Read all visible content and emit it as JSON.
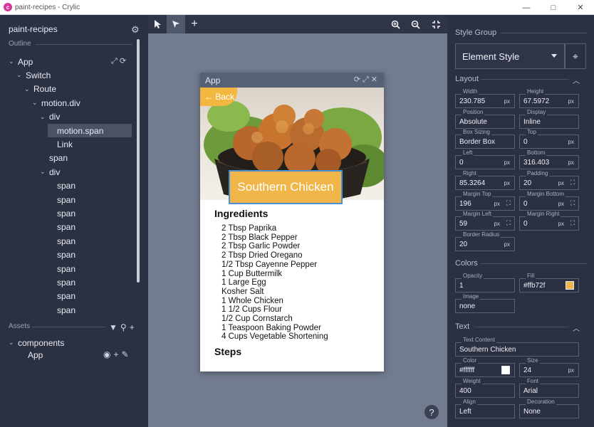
{
  "window": {
    "title": "paint-recipes - Crylic",
    "logo_glyph": "c",
    "controls": {
      "minimize": "—",
      "maximize": "□",
      "close": "✕"
    }
  },
  "left_panel": {
    "project_name": "paint-recipes",
    "outline_label": "Outline",
    "tree": [
      {
        "label": "App",
        "depth": 0,
        "expanded": true
      },
      {
        "label": "Switch",
        "depth": 1,
        "expanded": true
      },
      {
        "label": "Route",
        "depth": 2,
        "expanded": true
      },
      {
        "label": "motion.div",
        "depth": 3,
        "expanded": true
      },
      {
        "label": "div",
        "depth": 4,
        "expanded": true
      },
      {
        "label": "motion.span",
        "depth": 5,
        "selected": true
      },
      {
        "label": "Link",
        "depth": 5
      },
      {
        "label": "span",
        "depth": 4
      },
      {
        "label": "div",
        "depth": 4,
        "expanded": true
      },
      {
        "label": "span",
        "depth": 5
      },
      {
        "label": "span",
        "depth": 5
      },
      {
        "label": "span",
        "depth": 5
      },
      {
        "label": "span",
        "depth": 5
      },
      {
        "label": "span",
        "depth": 5
      },
      {
        "label": "span",
        "depth": 5
      },
      {
        "label": "span",
        "depth": 5
      },
      {
        "label": "span",
        "depth": 5
      },
      {
        "label": "span",
        "depth": 5
      },
      {
        "label": "span",
        "depth": 5
      }
    ],
    "assets_label": "Assets",
    "components_label": "components",
    "component_items": [
      "App"
    ]
  },
  "canvas": {
    "preview_title": "App",
    "back_label": "← Back",
    "recipe_title": "Southern Chicken",
    "ingredients_heading": "Ingredients",
    "ingredients": [
      "2 Tbsp Paprika",
      "2 Tbsp Black Pepper",
      "2 Tbsp Garlic Powder",
      "2 Tbsp Dried Oregano",
      "1/2 Tbsp Cayenne Pepper",
      "1 Cup Buttermilk",
      "1 Large Egg",
      "Kosher Salt",
      "1 Whole Chicken",
      "1 1/2 Cups Flour",
      "1/2 Cup Cornstarch",
      "1 Teaspoon Baking Powder",
      "4 Cups Vegetable Shortening"
    ],
    "steps_heading": "Steps",
    "help_glyph": "?"
  },
  "right_panel": {
    "style_group_label": "Style Group",
    "style_group_value": "Element Style",
    "layout_label": "Layout",
    "layout_fields": {
      "width": {
        "label": "Width",
        "value": "230.785",
        "unit": "px"
      },
      "height": {
        "label": "Height",
        "value": "67.5972",
        "unit": "px"
      },
      "position": {
        "label": "Position",
        "value": "Absolute"
      },
      "display": {
        "label": "Display",
        "value": "Inline"
      },
      "box_sizing": {
        "label": "Box Sizing",
        "value": "Border Box"
      },
      "top": {
        "label": "Top",
        "value": "0",
        "unit": "px"
      },
      "left": {
        "label": "Left",
        "value": "0",
        "unit": "px"
      },
      "bottom": {
        "label": "Bottom",
        "value": "316.403",
        "unit": "px"
      },
      "right": {
        "label": "Right",
        "value": "85.3264",
        "unit": "px"
      },
      "padding": {
        "label": "Padding",
        "value": "20",
        "unit": "px"
      },
      "margin_top": {
        "label": "Margin Top",
        "value": "196",
        "unit": "px"
      },
      "margin_bottom": {
        "label": "Margin Bottom",
        "value": "0",
        "unit": "px"
      },
      "margin_left": {
        "label": "Margin Left",
        "value": "59",
        "unit": "px"
      },
      "margin_right": {
        "label": "Margin Right",
        "value": "0",
        "unit": "px"
      },
      "border_radius": {
        "label": "Border Radius",
        "value": "20",
        "unit": "px"
      }
    },
    "colors_label": "Colors",
    "color_fields": {
      "opacity": {
        "label": "Opacity",
        "value": "1"
      },
      "fill": {
        "label": "Fill",
        "value": "#ffb72f"
      },
      "image": {
        "label": "Image",
        "value": "none"
      }
    },
    "text_label": "Text",
    "text_fields": {
      "content": {
        "label": "Text Content",
        "value": "Southern Chicken"
      },
      "color": {
        "label": "Color",
        "value": "#ffffff"
      },
      "size": {
        "label": "Size",
        "value": "24",
        "unit": "px"
      },
      "weight": {
        "label": "Weight",
        "value": "400"
      },
      "font": {
        "label": "Font",
        "value": "Arial"
      },
      "align": {
        "label": "Align",
        "value": "Left"
      },
      "decoration": {
        "label": "Decoration",
        "value": "None"
      }
    }
  },
  "colors": {
    "panel_bg": "#2b3142",
    "canvas_bg": "#737b8f",
    "accent_orange": "#f3b73f",
    "selection_blue": "#4c8fd9"
  }
}
